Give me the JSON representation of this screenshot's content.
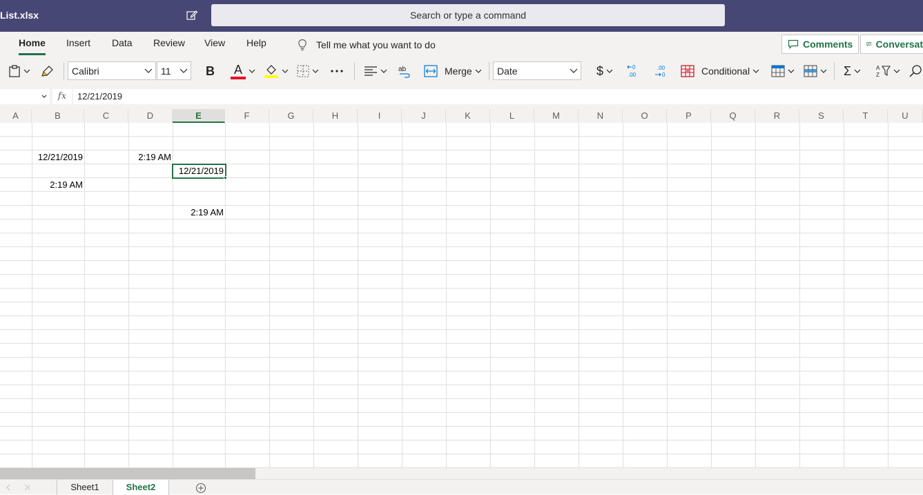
{
  "app": {
    "file_name": "List.xlsx",
    "search_placeholder": "Search or type a command"
  },
  "ribbon_tabs": [
    "Home",
    "Insert",
    "Data",
    "Review",
    "View",
    "Help"
  ],
  "active_tab": "Home",
  "tell_me": "Tell me what you want to do",
  "top_buttons": {
    "comments": "Comments",
    "conversation": "Conversat"
  },
  "ribbon": {
    "font_name": "Calibri",
    "font_size": "11",
    "bold": "B",
    "font_color_letter": "A",
    "merge": "Merge",
    "number_format": "Date",
    "currency": "$",
    "conditional": "Conditional",
    "sum": "Σ",
    "font_color": "#e81123",
    "highlight_color": "#ffff00"
  },
  "formula_bar": {
    "name_box": "",
    "fx": "fx",
    "value": "12/21/2019"
  },
  "columns": [
    "A",
    "B",
    "C",
    "D",
    "E",
    "F",
    "G",
    "H",
    "I",
    "J",
    "K",
    "L",
    "M",
    "N",
    "O",
    "P",
    "Q",
    "R",
    "S",
    "T",
    "U"
  ],
  "selected_column": "E",
  "cells": {
    "B3": "12/21/2019",
    "D3": "2:19 AM",
    "E4": "12/21/2019",
    "B5": "2:19 AM",
    "E7": "2:19 AM"
  },
  "sheets": [
    "Sheet1",
    "Sheet2"
  ],
  "active_sheet": "Sheet2",
  "accent_color": "#217346",
  "titlebar_color": "#464775"
}
